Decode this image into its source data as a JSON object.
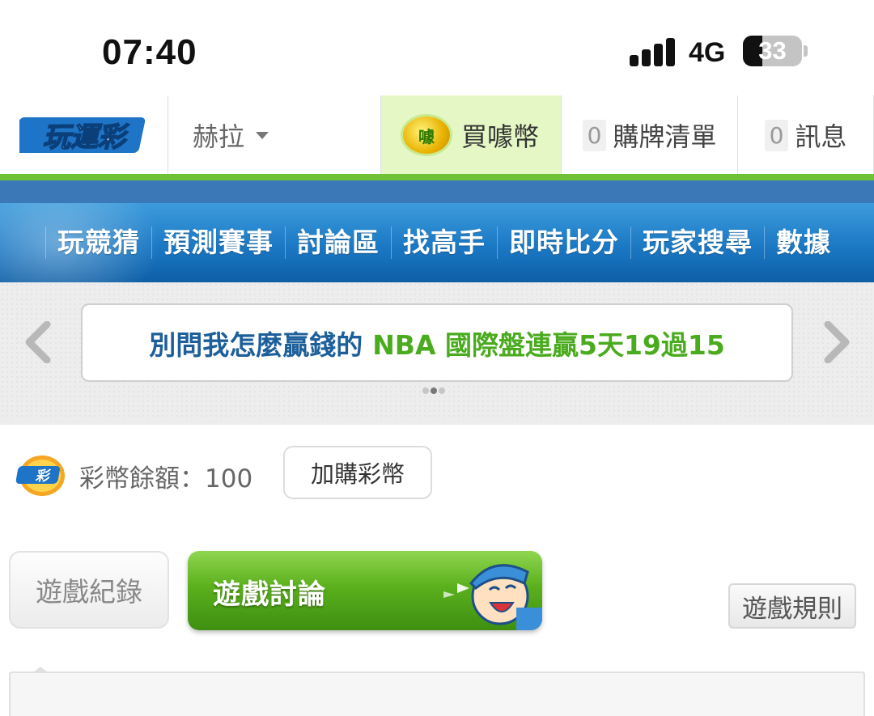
{
  "status_bar": {
    "time": "07:40",
    "network": "4G",
    "battery": "33",
    "battery_fraction": 0.33
  },
  "top_nav": {
    "logo_text": "玩運彩",
    "user_name": "赫拉",
    "buy_coin_badge": "噱",
    "buy_label": "買噱幣",
    "list_count": "0",
    "list_label": "購牌清單",
    "message_count": "0",
    "message_label": "訊息"
  },
  "menu": {
    "items": [
      "玩競猜",
      "預測賽事",
      "討論區",
      "找高手",
      "即時比分",
      "玩家搜尋",
      "數據"
    ]
  },
  "banner": {
    "text_part1": "別問我怎麼贏錢的",
    "text_part2": "NBA 國際盤連贏5天19過15",
    "slide_count": 3,
    "active_slide": 2
  },
  "balance": {
    "coin_logo_text": "彩",
    "label": "彩幣餘額：100",
    "buy_more": "加購彩幣"
  },
  "tabs": {
    "history": "遊戲紀錄",
    "discussion": "遊戲討論",
    "rules": "遊戲規則"
  },
  "colors": {
    "accent_green": "#6fc136",
    "nav_blue": "#1b78c4",
    "banner_blue_text": "#1d5f9a",
    "banner_green_text": "#4aab1e",
    "buy_highlight": "#e5f7c5"
  }
}
